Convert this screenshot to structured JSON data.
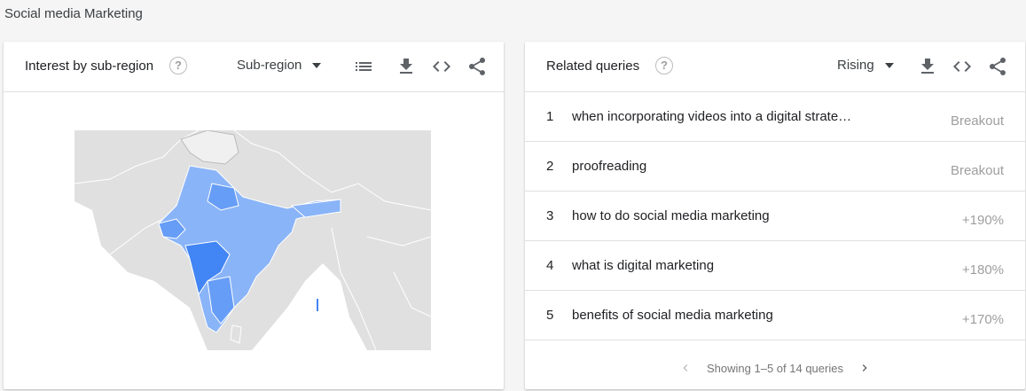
{
  "page_title": "Social media Marketing",
  "left_card": {
    "title": "Interest by sub-region",
    "help_icon": "help-circle-icon",
    "dropdown_label": "Sub-region",
    "tools": [
      "list-icon",
      "download-icon",
      "embed-code-icon",
      "share-icon"
    ]
  },
  "right_card": {
    "title": "Related queries",
    "help_icon": "help-circle-icon",
    "dropdown_label": "Rising",
    "tools": [
      "download-icon",
      "embed-code-icon",
      "share-icon"
    ],
    "queries": [
      {
        "rank": "1",
        "text": "when incorporating videos into a digital strate…",
        "value": "Breakout"
      },
      {
        "rank": "2",
        "text": "proofreading",
        "value": "Breakout"
      },
      {
        "rank": "3",
        "text": "how to do social media marketing",
        "value": "+190%"
      },
      {
        "rank": "4",
        "text": "what is digital marketing",
        "value": "+180%"
      },
      {
        "rank": "5",
        "text": "benefits of social media marketing",
        "value": "+170%"
      }
    ],
    "pager_text": "Showing 1–5 of 14 queries"
  },
  "colors": {
    "map_background": "#e0e0e0",
    "map_light": "#8ab4f8",
    "map_medium": "#669df6",
    "map_dark": "#4285f4"
  }
}
